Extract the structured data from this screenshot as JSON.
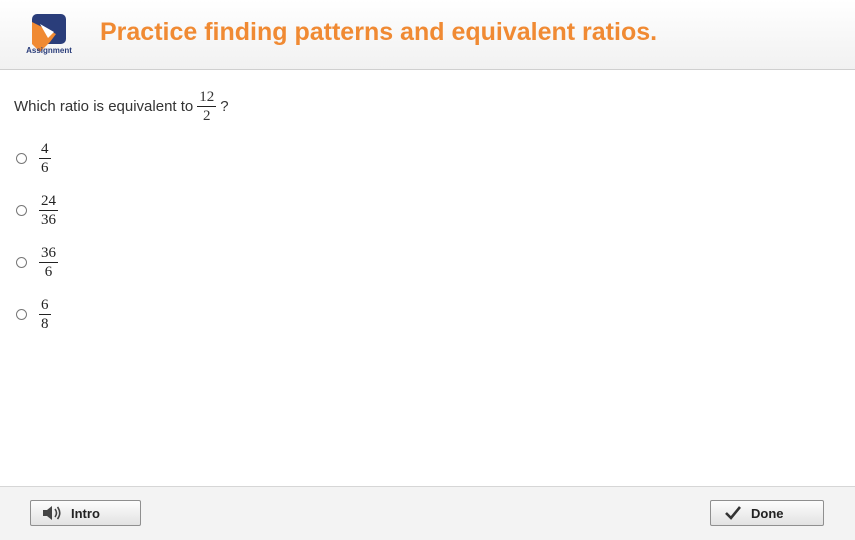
{
  "header": {
    "logo_label": "Assignment",
    "title": "Practice finding patterns and equivalent ratios."
  },
  "question": {
    "prompt": "Which ratio is equivalent to",
    "fraction": {
      "numerator": "12",
      "denominator": "2"
    },
    "suffix": "?"
  },
  "options": [
    {
      "numerator": "4",
      "denominator": "6"
    },
    {
      "numerator": "24",
      "denominator": "36"
    },
    {
      "numerator": "36",
      "denominator": "6"
    },
    {
      "numerator": "6",
      "denominator": "8"
    }
  ],
  "footer": {
    "intro_label": "Intro",
    "done_label": "Done"
  },
  "colors": {
    "title": "#f08a33",
    "logo_orange": "#f08a33",
    "logo_blue": "#2a3d7a"
  },
  "icons": {
    "logo": "assignment-logo-icon",
    "intro": "speaker-icon",
    "done": "checkmark-icon"
  }
}
